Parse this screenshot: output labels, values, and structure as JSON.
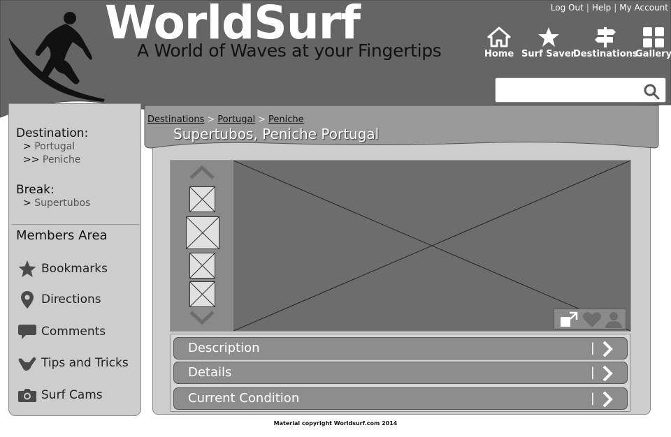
{
  "header": {
    "brand": "WorldSurf",
    "tagline": "A World of Waves at your Fingertips",
    "account_links": [
      "Log Out",
      "Help",
      "My Account"
    ],
    "nav": [
      {
        "label": "Home",
        "icon": "home-icon"
      },
      {
        "label": "Surf Saver",
        "icon": "star-icon"
      },
      {
        "label": "Destinations",
        "icon": "signpost-icon"
      },
      {
        "label": "Gallery",
        "icon": "grid-icon"
      }
    ],
    "search": {
      "value": "",
      "placeholder": "",
      "icon": "search-icon"
    }
  },
  "sidebar": {
    "destination_heading": "Destination:",
    "destination_items": [
      {
        "prefix": ">",
        "label": "Portugal"
      },
      {
        "prefix": ">>",
        "label": "Peniche"
      }
    ],
    "break_heading": "Break:",
    "break_items": [
      {
        "prefix": ">",
        "label": "Supertubos"
      }
    ],
    "members_heading": "Members Area",
    "menu": [
      {
        "label": "Bookmarks",
        "icon": "star-icon"
      },
      {
        "label": "Directions",
        "icon": "map-pin-icon"
      },
      {
        "label": "Comments",
        "icon": "speech-bubble-icon"
      },
      {
        "label": "Tips and Tricks",
        "icon": "shaka-hand-icon"
      },
      {
        "label": "Surf Cams",
        "icon": "camera-icon"
      }
    ]
  },
  "main": {
    "breadcrumb": [
      "Destinations",
      "Portugal",
      "Peniche"
    ],
    "breadcrumb_separator": ">",
    "title": "Supertubos, Peniche Portugal",
    "image_actions": [
      "expand-icon",
      "heart-icon",
      "person-icon"
    ],
    "accordion": [
      {
        "label": "Description"
      },
      {
        "label": "Details"
      },
      {
        "label": "Current Condition"
      }
    ]
  },
  "footer": {
    "copyright": "Material copyright Worldsurf.com 2014"
  },
  "colors": {
    "header": "#656565",
    "panel": "#cdcdcd",
    "accent_dark": "#6d6d6d"
  }
}
